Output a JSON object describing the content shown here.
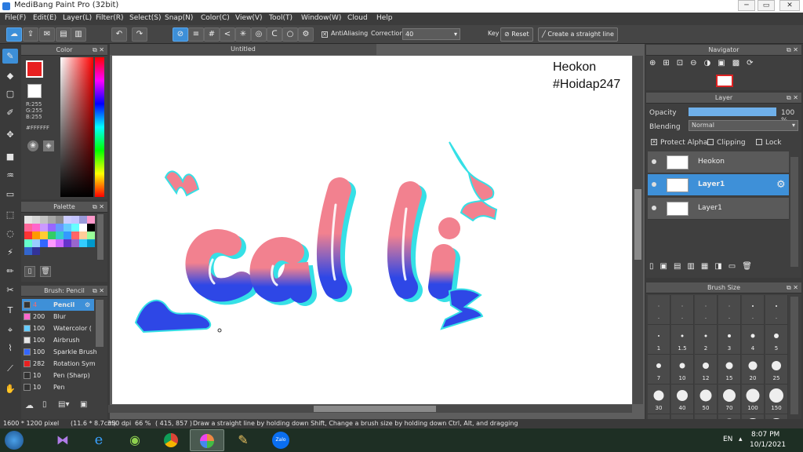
{
  "window": {
    "title": "MediBang Paint Pro (32bit)",
    "min": "─",
    "max": "▭",
    "close": "✕"
  },
  "menu": [
    "File(F)",
    "Edit(E)",
    "Layer(L)",
    "Filter(R)",
    "Select(S)",
    "Snap(N)",
    "Color(C)",
    "View(V)",
    "Tool(T)",
    "Window(W)",
    "Cloud",
    "Help"
  ],
  "toolbar": {
    "antialiasing": "AntiAliasing",
    "correction_label": "Correction",
    "correction_value": "40",
    "key_label": "Key",
    "reset_label": "Reset",
    "straight_line_label": "Create a straight line"
  },
  "document": {
    "tab": "Untitled"
  },
  "canvas": {
    "watermark_line1": "Heokon",
    "watermark_line2": "#Hoidap247"
  },
  "color_panel": {
    "title": "Color",
    "r": "R:255",
    "g": "G:255",
    "b": "B:255",
    "hex": "#FFFFFF",
    "fg": "#e82020",
    "bg": "#ffffff"
  },
  "palette_panel": {
    "title": "Palette",
    "swatches": [
      "#e6e6e6",
      "#d7d7d7",
      "#c3c3c3",
      "#a7a7a7",
      "#8e8e8e",
      "#ccccff",
      "#c4c4ff",
      "#9999d9",
      "#ff99cc",
      "#ff6699",
      "#ff66cc",
      "#cc99ff",
      "#9966ff",
      "#6699ff",
      "#66ccff",
      "#66ffff",
      "#ffffff",
      "#000000",
      "#ff3333",
      "#ff9900",
      "#ffcc33",
      "#33cc66",
      "#33cccc",
      "#3399ff",
      "#ff6666",
      "#ffcc99",
      "#99ff99",
      "#66ffcc",
      "#99ccff",
      "#3366ff",
      "#ff99ff",
      "#cc66ff",
      "#6633cc",
      "#9966cc",
      "#33ccff",
      "#0099cc",
      "#3366cc",
      "#333399"
    ]
  },
  "brush_panel": {
    "title": "Brush: Pencil",
    "items": [
      {
        "size": "4",
        "name": "Pencil",
        "color": "#333333",
        "selected": true
      },
      {
        "size": "200",
        "name": "Blur",
        "color": "#ff66cc"
      },
      {
        "size": "100",
        "name": "Watercolor (",
        "color": "#66ccff"
      },
      {
        "size": "100",
        "name": "Airbrush",
        "color": "#e6e6e6"
      },
      {
        "size": "100",
        "name": "Sparkle Brush",
        "color": "#3366ff"
      },
      {
        "size": "282",
        "name": "Rotation Sym",
        "color": "#e82020"
      },
      {
        "size": "10",
        "name": "Pen (Sharp)",
        "color": "#333333"
      },
      {
        "size": "10",
        "name": "Pen",
        "color": "#333333"
      }
    ]
  },
  "navigator": {
    "title": "Navigator"
  },
  "layer_panel": {
    "title": "Layer",
    "opacity_label": "Opacity",
    "opacity_value": "100 %",
    "opacity_fraction": 1.0,
    "blending_label": "Blending",
    "blending_value": "Normal",
    "protect_alpha": "Protect Alpha",
    "clipping": "Clipping",
    "lock": "Lock",
    "layers": [
      {
        "name": "Heokon",
        "selected": false
      },
      {
        "name": "Layer1",
        "selected": true
      },
      {
        "name": "Layer1",
        "selected": false
      }
    ]
  },
  "brush_size_panel": {
    "title": "Brush Size",
    "sizes": [
      "·",
      "·",
      "·",
      "·",
      "·",
      "·",
      "1",
      "1.5",
      "2",
      "3",
      "4",
      "5",
      "7",
      "10",
      "12",
      "15",
      "20",
      "25",
      "30",
      "40",
      "50",
      "70",
      "100",
      "150",
      "200",
      "300",
      "400",
      "500",
      "700",
      "1000"
    ]
  },
  "status": {
    "size": "1600 * 1200 pixel",
    "cm": "(11.6 * 8.7cm)",
    "dpi": "350 dpi",
    "zoom": "66 %",
    "coords": "( 415, 857 )",
    "hint": "Draw a straight line by holding down Shift, Change a brush size by holding down Ctrl, Alt, and dragging"
  },
  "taskbar": {
    "lang": "EN",
    "time": "8:07 PM",
    "date": "10/1/2021",
    "zalo": "Zalo"
  }
}
